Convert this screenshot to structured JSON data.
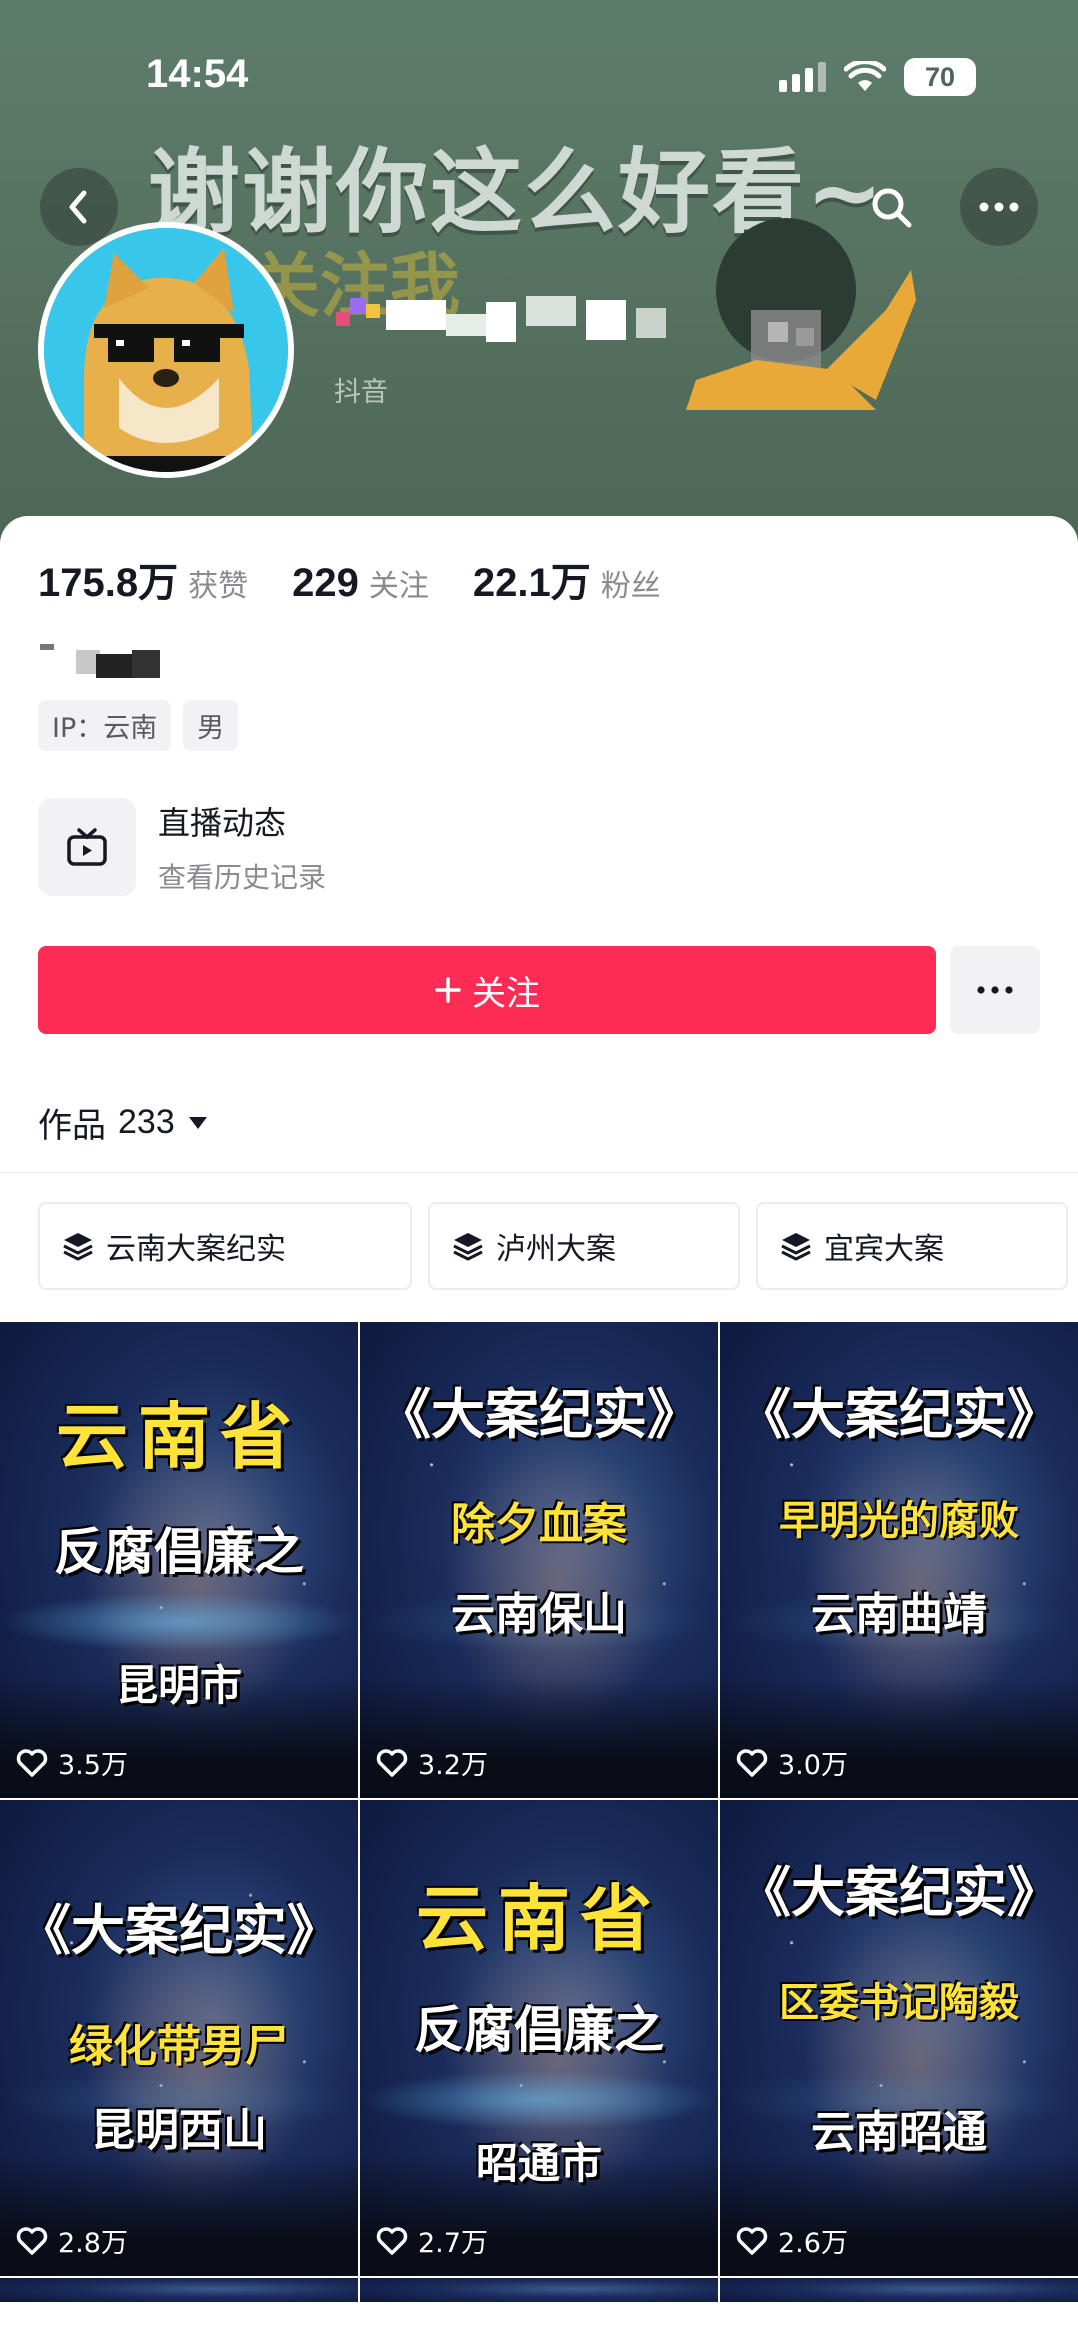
{
  "status_bar": {
    "time": "14:54",
    "battery": "70"
  },
  "banner": {
    "title": "谢谢你这么好看~",
    "subtitle": "关注我"
  },
  "profile": {
    "platform_label": "抖音"
  },
  "stats": [
    {
      "value": "175.8万",
      "label": "获赞"
    },
    {
      "value": "229",
      "label": "关注"
    },
    {
      "value": "22.1万",
      "label": "粉丝"
    }
  ],
  "tags": [
    "IP：云南",
    "男"
  ],
  "live": {
    "title": "直播动态",
    "subtitle": "查看历史记录"
  },
  "follow_button": "关注",
  "works": {
    "label": "作品",
    "count": "233"
  },
  "collections": [
    "云南大案纪实",
    "泸州大案",
    "宜宾大案"
  ],
  "videos": [
    {
      "line1": "云南省",
      "line2": "反腐倡廉之",
      "line3": "昆明市",
      "likes": "3.5万"
    },
    {
      "line1": "《大案纪实》",
      "line2": "除夕血案",
      "line3": "云南保山",
      "likes": "3.2万"
    },
    {
      "line1": "《大案纪实》",
      "line2": "早明光的腐败",
      "line3": "云南曲靖",
      "likes": "3.0万"
    },
    {
      "line1": "《大案纪实》",
      "line2": "绿化带男尸",
      "line3": "昆明西山",
      "likes": "2.8万"
    },
    {
      "line1": "云南省",
      "line2": "反腐倡廉之",
      "line3": "昭通市",
      "likes": "2.7万"
    },
    {
      "line1": "《大案纪实》",
      "line2": "区委书记陶毅",
      "line3": "云南昭通",
      "likes": "2.6万"
    }
  ],
  "colors": {
    "accent": "#fe2c55",
    "banner": "#55705f",
    "text_secondary": "#8a8b91"
  }
}
